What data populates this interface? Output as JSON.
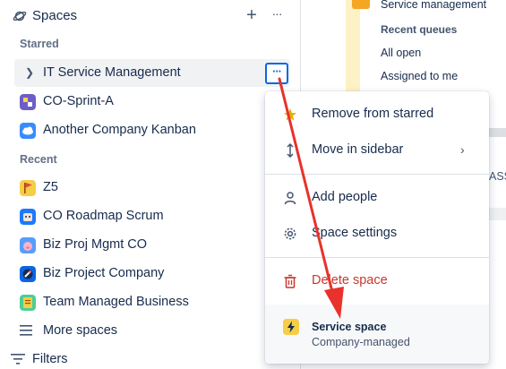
{
  "sidebar": {
    "title": "Spaces",
    "add_glyph": "+",
    "more_glyph": "···",
    "starred_label": "Starred",
    "recent_label": "Recent",
    "starred": [
      {
        "label": "IT Service Management",
        "icon": "chevron-right-icon",
        "selected": true,
        "more_glyph": "···"
      },
      {
        "label": "CO-Sprint-A",
        "icon": "purple-project-avatar"
      },
      {
        "label": "Another Company Kanban",
        "icon": "blue-cloud-avatar"
      }
    ],
    "recent": [
      {
        "label": "Z5",
        "icon": "yellow-flag-avatar"
      },
      {
        "label": "CO Roadmap Scrum",
        "icon": "blue-robot-avatar"
      },
      {
        "label": "Biz Proj Mgmt CO",
        "icon": "pink-pig-avatar"
      },
      {
        "label": "Biz Project Company",
        "icon": "blue-rocket-avatar"
      },
      {
        "label": "Team Managed Business",
        "icon": "yellow-notebook-avatar"
      }
    ],
    "more_spaces": "More spaces",
    "filters": "Filters"
  },
  "background": {
    "project_name": "Service management",
    "recent_queues": "Recent queues",
    "all_open": "All open",
    "assigned_to_me": "Assigned to me",
    "partial_text": "ASS"
  },
  "menu": {
    "items": [
      {
        "label": "Remove from starred",
        "icon": "star-icon"
      },
      {
        "label": "Move in sidebar",
        "icon": "move-vertical-icon",
        "has_submenu": true
      },
      {
        "label": "Add people",
        "icon": "person-icon"
      },
      {
        "label": "Space settings",
        "icon": "gear-icon"
      },
      {
        "label": "Delete space",
        "icon": "trash-icon",
        "danger": true
      }
    ],
    "space_type": {
      "title": "Service space",
      "subtitle": "Company-managed"
    }
  },
  "colors": {
    "accent": "#0c66e4",
    "danger": "#c9372c",
    "annotation_arrow": "#e8322b",
    "star": "#e2b203"
  }
}
